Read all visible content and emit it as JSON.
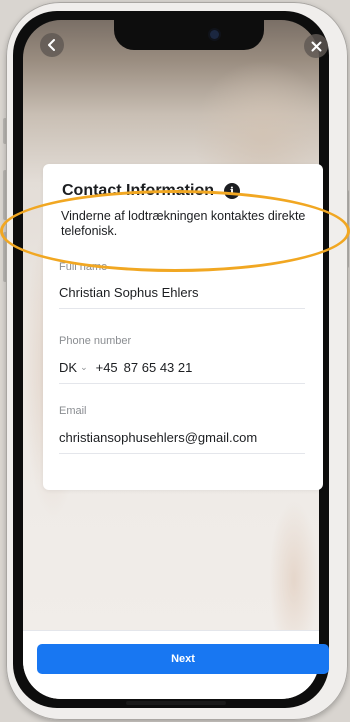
{
  "header": {
    "back_icon": "chevron-left-icon",
    "close_icon": "close-icon"
  },
  "card": {
    "title": "Contact Information",
    "info_icon_glyph": "i",
    "description": "Vinderne af lodtrækningen kontaktes direkte telefonisk.",
    "fields": {
      "full_name": {
        "label": "Full name",
        "value": "Christian Sophus Ehlers"
      },
      "phone": {
        "label": "Phone number",
        "country": "DK",
        "dial_code": "+45",
        "number": "87 65 43 21"
      },
      "email": {
        "label": "Email",
        "value": "christiansophusehlers@gmail.com"
      }
    }
  },
  "footer": {
    "next_label": "Next"
  },
  "colors": {
    "accent": "#1877f2",
    "highlight": "#f1a722",
    "text": "#1c1e21",
    "muted": "#8a8d91"
  }
}
